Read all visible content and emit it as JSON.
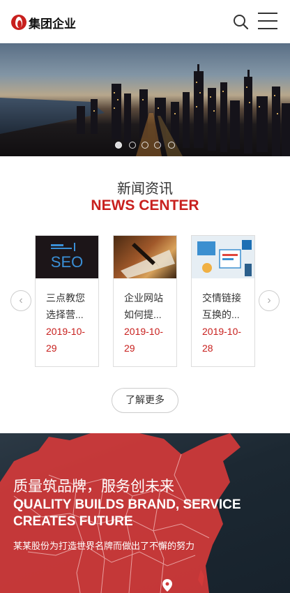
{
  "header": {
    "logo_text": "集团企业",
    "search_icon": "search-icon",
    "menu_icon": "hamburger-menu-icon"
  },
  "banner": {
    "slides": 5,
    "active_slide": 1
  },
  "news": {
    "title_cn": "新闻资讯",
    "title_en": "NEWS CENTER",
    "prev_icon": "chevron-left-icon",
    "next_icon": "chevron-right-icon",
    "items": [
      {
        "title": "三点教您选择营...",
        "date": "2019-10-29",
        "thumb_text": "SEO"
      },
      {
        "title": "企业网站如何提...",
        "date": "2019-10-29"
      },
      {
        "title": "交情链接互换的...",
        "date": "2019-10-28"
      }
    ],
    "more_label": "了解更多"
  },
  "promo": {
    "title_cn": "质量筑品牌，服务创未来",
    "title_en": "QUALITY BUILDS BRAND, SERVICE CREATES FUTURE",
    "description": "某某股份为打造世界名牌而做出了不懈的努力",
    "pin_icon": "location-pin-icon"
  },
  "colors": {
    "accent": "#c8201e",
    "dark_bg": "#1c2832"
  }
}
